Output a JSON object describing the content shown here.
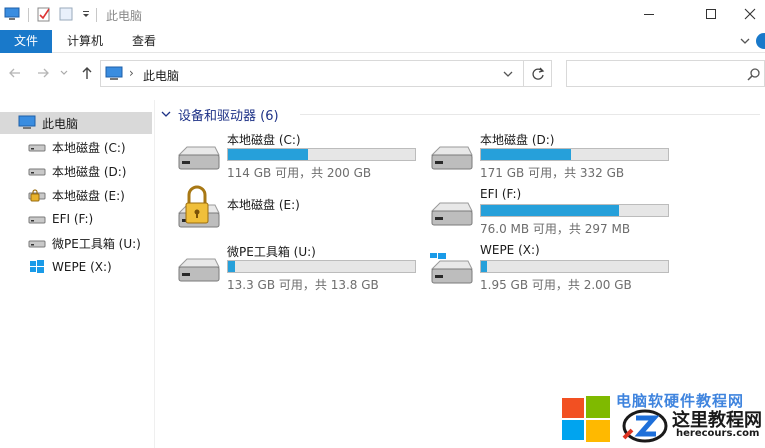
{
  "window": {
    "title": "此电脑",
    "minimize_glyph": "—",
    "maximize_glyph": "☐",
    "close_glyph": "✕"
  },
  "ribbon": {
    "tabs": [
      {
        "label": "文件",
        "active": true
      },
      {
        "label": "计算机",
        "active": false
      },
      {
        "label": "查看",
        "active": false
      }
    ]
  },
  "address": {
    "separator": "›",
    "breadcrumb": "此电脑",
    "search_placeholder": ""
  },
  "nav": {
    "items": [
      {
        "label": "此电脑",
        "icon": "pc-icon",
        "selected": true
      },
      {
        "label": "本地磁盘 (C:)",
        "icon": "drive-icon"
      },
      {
        "label": "本地磁盘 (D:)",
        "icon": "drive-icon"
      },
      {
        "label": "本地磁盘 (E:)",
        "icon": "locked-drive-icon"
      },
      {
        "label": "EFI (F:)",
        "icon": "drive-icon"
      },
      {
        "label": "微PE工具箱 (U:)",
        "icon": "drive-icon"
      },
      {
        "label": "WEPE (X:)",
        "icon": "windows-drive-icon"
      }
    ]
  },
  "content": {
    "group_title": "设备和驱动器 (6)",
    "drives": [
      {
        "name": "本地磁盘 (C:)",
        "size_text": "114 GB 可用，共 200 GB",
        "used_fraction": 0.43,
        "icon": "drive-icon"
      },
      {
        "name": "本地磁盘 (D:)",
        "size_text": "171 GB 可用，共 332 GB",
        "used_fraction": 0.48,
        "icon": "drive-icon"
      },
      {
        "name": "本地磁盘 (E:)",
        "size_text": "",
        "used_fraction": null,
        "icon": "locked-drive-icon"
      },
      {
        "name": "EFI (F:)",
        "size_text": "76.0 MB 可用，共 297 MB",
        "used_fraction": 0.74,
        "icon": "drive-icon"
      },
      {
        "name": "微PE工具箱 (U:)",
        "size_text": "13.3 GB 可用，共 13.8 GB",
        "used_fraction": 0.04,
        "icon": "drive-icon"
      },
      {
        "name": "WEPE (X:)",
        "size_text": "1.95 GB 可用，共 2.00 GB",
        "used_fraction": 0.03,
        "icon": "windows-drive-icon"
      }
    ]
  },
  "watermark": {
    "top_text": "电脑软硬件教程网",
    "brand": "这里教程网",
    "url": "herecours.com"
  },
  "colors": {
    "accent": "#1979ca",
    "usage_bar": "#26a0da",
    "group_title": "#1e3287"
  }
}
